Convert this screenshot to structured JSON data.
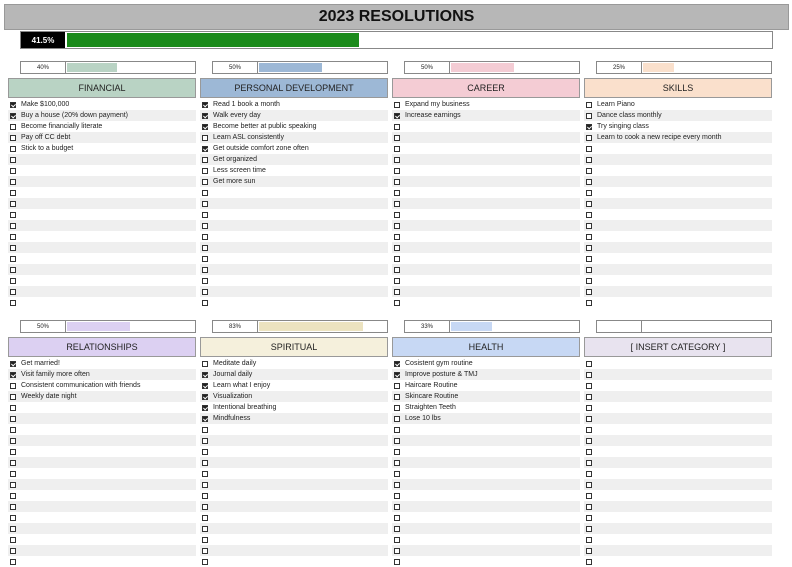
{
  "title": "2023 RESOLUTIONS",
  "overall": {
    "percent_label": "41.5%",
    "fraction": 0.415,
    "color": "#1a8a1a"
  },
  "categories": [
    {
      "name": "FINANCIAL",
      "percent_label": "40%",
      "fraction": 0.4,
      "header_color": "#b9d3c4",
      "bar_color": "#b9d3c4",
      "items": [
        {
          "text": "Make $100,000",
          "checked": true
        },
        {
          "text": "Buy a house (20% down payment)",
          "checked": true
        },
        {
          "text": "Become financially literate",
          "checked": false
        },
        {
          "text": "Pay off CC debt",
          "checked": false
        },
        {
          "text": "Stick to a budget",
          "checked": false
        }
      ]
    },
    {
      "name": "PERSONAL DEVELOPMENT",
      "percent_label": "50%",
      "fraction": 0.5,
      "header_color": "#9db8d6",
      "bar_color": "#9db8d6",
      "items": [
        {
          "text": "Read 1 book a month",
          "checked": true
        },
        {
          "text": "Walk every day",
          "checked": true
        },
        {
          "text": "Become better at public speaking",
          "checked": true
        },
        {
          "text": "Learn ASL consistently",
          "checked": false
        },
        {
          "text": "Get outside comfort zone often",
          "checked": true
        },
        {
          "text": "Get organized",
          "checked": false
        },
        {
          "text": "Less screen time",
          "checked": false
        },
        {
          "text": "Get more sun",
          "checked": false
        }
      ]
    },
    {
      "name": "CAREER",
      "percent_label": "50%",
      "fraction": 0.5,
      "header_color": "#f4ccd4",
      "bar_color": "#f4ccd4",
      "items": [
        {
          "text": "Expand my business",
          "checked": false
        },
        {
          "text": "Increase earnings",
          "checked": true
        }
      ]
    },
    {
      "name": "SKILLS",
      "percent_label": "25%",
      "fraction": 0.25,
      "header_color": "#fae0cc",
      "bar_color": "#fae0cc",
      "items": [
        {
          "text": "Learn Piano",
          "checked": false
        },
        {
          "text": "Dance class monthly",
          "checked": false
        },
        {
          "text": "Try singing class",
          "checked": true
        },
        {
          "text": "Learn to cook a new recipe every month",
          "checked": false
        }
      ]
    },
    {
      "name": "RELATIONSHIPS",
      "percent_label": "50%",
      "fraction": 0.5,
      "header_color": "#dcd0f2",
      "bar_color": "#dcd0f2",
      "items": [
        {
          "text": "Get married!",
          "checked": true
        },
        {
          "text": "Visit family more often",
          "checked": true
        },
        {
          "text": "Consistent communication with friends",
          "checked": false
        },
        {
          "text": "Weekly date night",
          "checked": false
        }
      ]
    },
    {
      "name": "SPIRITUAL",
      "percent_label": "83%",
      "fraction": 0.83,
      "header_color": "#f5f0dc",
      "bar_color": "#ece3c0",
      "items": [
        {
          "text": "Meditate daily",
          "checked": false
        },
        {
          "text": "Journal daily",
          "checked": true
        },
        {
          "text": "Learn what I enjoy",
          "checked": true
        },
        {
          "text": "Visualization",
          "checked": true
        },
        {
          "text": "Intentional breathing",
          "checked": true
        },
        {
          "text": "Mindfulness",
          "checked": true
        }
      ]
    },
    {
      "name": "HEALTH",
      "percent_label": "33%",
      "fraction": 0.33,
      "header_color": "#c7d8f4",
      "bar_color": "#c7d8f4",
      "items": [
        {
          "text": "Cosistent gym routine",
          "checked": true
        },
        {
          "text": "Improve posture & TMJ",
          "checked": true
        },
        {
          "text": "Haircare Routine",
          "checked": false
        },
        {
          "text": "Skincare Routine",
          "checked": false
        },
        {
          "text": "Straighten Teeth",
          "checked": false
        },
        {
          "text": "Lose 10 lbs",
          "checked": false
        }
      ]
    },
    {
      "name": "[ INSERT CATEGORY ]",
      "percent_label": "",
      "fraction": 0,
      "header_color": "#e8e3ef",
      "bar_color": "#e8e3ef",
      "items": []
    }
  ]
}
